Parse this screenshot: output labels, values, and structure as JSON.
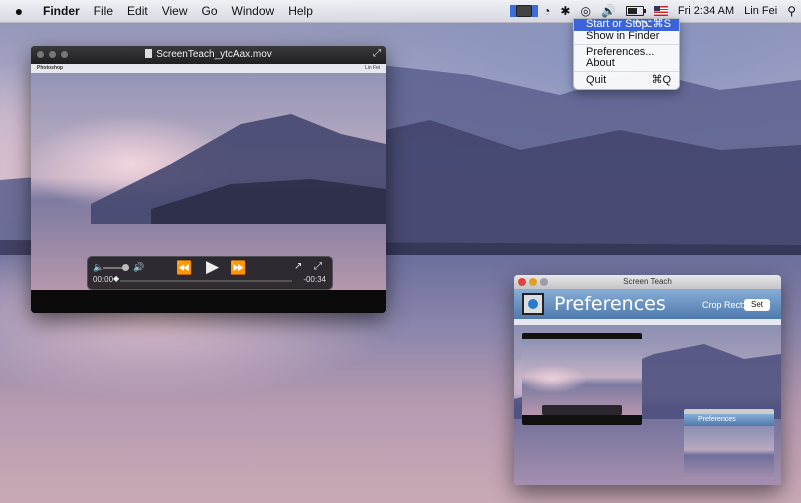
{
  "menubar": {
    "app_name": "Finder",
    "menus": [
      "File",
      "Edit",
      "View",
      "Go",
      "Window",
      "Help"
    ],
    "clock": "Fri 2:34 AM",
    "user": "Lin Fei"
  },
  "status_menu": {
    "items": [
      {
        "label": "Start or Stop",
        "shortcut": "^⌥⌘S",
        "highlighted": true
      },
      {
        "label": "Show in Finder",
        "shortcut": ""
      },
      {
        "label": "Preferences...",
        "shortcut": ""
      },
      {
        "label": "About",
        "shortcut": ""
      },
      {
        "label": "Quit",
        "shortcut": "⌘Q"
      }
    ]
  },
  "player": {
    "file_name": "ScreenTeach_ytcAax.mov",
    "inner_app": "Photoshop",
    "inner_user": "Lin Fei",
    "current_time": "00:00",
    "remaining_time": "-00:34",
    "progress": 0
  },
  "prefs_window": {
    "title": "Screen Teach",
    "header": "Preferences",
    "crop_label": "Crop Rect:",
    "set_button": "Set",
    "mini_header": "Preferences"
  },
  "colors": {
    "menu_highlight": "#3a64d8",
    "close": "#e0443e",
    "minimize": "#dea123",
    "zoom": "#9aa0a8"
  }
}
